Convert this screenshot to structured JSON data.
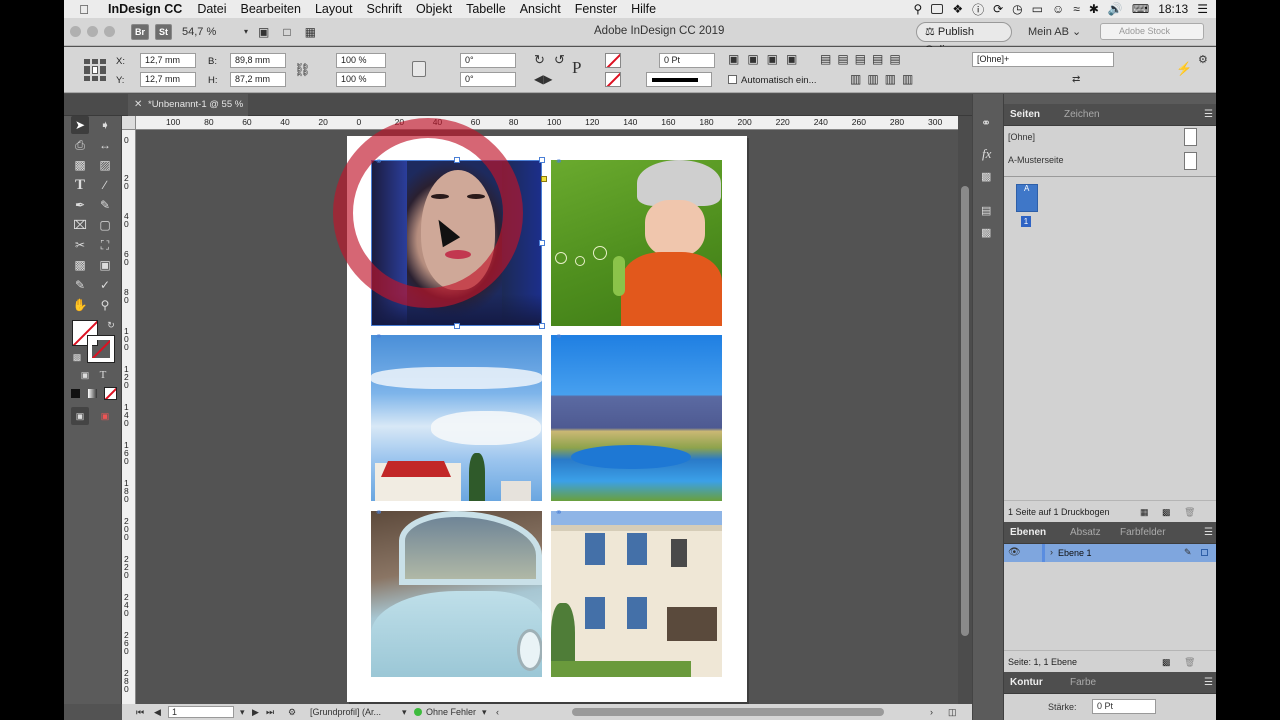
{
  "menubar": {
    "app_name": "InDesign CC",
    "items": [
      "Datei",
      "Bearbeiten",
      "Layout",
      "Schrift",
      "Objekt",
      "Tabelle",
      "Ansicht",
      "Fenster",
      "Hilfe"
    ],
    "time": "18:13"
  },
  "appbar": {
    "bridge_label": "Br",
    "stock_label": "St",
    "zoom": "54,7 %",
    "window_title": "Adobe InDesign CC 2019",
    "publish_online": "Publish Online",
    "workspace": "Mein AB",
    "stock_search_placeholder": "Adobe Stock"
  },
  "control": {
    "x_label": "X:",
    "x_value": "12,7 mm",
    "y_label": "Y:",
    "y_value": "12,7 mm",
    "w_label": "B:",
    "w_value": "89,8 mm",
    "h_label": "H:",
    "h_value": "87,2 mm",
    "scale_x": "100 %",
    "scale_y": "100 %",
    "rotation": "0°",
    "shear": "0°",
    "stroke_weight": "0 Pt",
    "auto_fit_label": "Automatisch ein...",
    "object_style": "[Ohne]+"
  },
  "document_tab": {
    "label": "*Unbenannt-1 @ 55 %"
  },
  "rulers": {
    "horizontal": [
      "100",
      "80",
      "60",
      "40",
      "20",
      "0",
      "20",
      "40",
      "60",
      "80",
      "100",
      "120",
      "140",
      "160",
      "180",
      "200",
      "220",
      "240",
      "260",
      "280",
      "300"
    ],
    "vertical": [
      "0",
      "2 0",
      "4 0",
      "6 0",
      "8 0",
      "1 0 0",
      "1 2 0",
      "1 4 0",
      "1 6 0",
      "1 8 0",
      "2 0 0",
      "2 2 0",
      "2 4 0",
      "2 6 0",
      "2 8 0"
    ]
  },
  "status": {
    "page": "1",
    "profile": "[Grundprofil] (Ar...",
    "preflight": "Ohne Fehler"
  },
  "pages_panel": {
    "tabs": [
      "Seiten",
      "Zeichen"
    ],
    "none_master": "[Ohne]",
    "a_master": "A-Musterseite",
    "page_thumb_label": "A",
    "page_number": "1",
    "footer": "1 Seite auf 1 Druckbogen"
  },
  "layers_panel": {
    "tabs": [
      "Ebenen",
      "Absatz",
      "Farbfelder"
    ],
    "layer_name": "Ebene 1",
    "footer": "Seite: 1, 1 Ebene"
  },
  "stroke_panel": {
    "tabs": [
      "Kontur",
      "Farbe"
    ],
    "weight_label": "Stärke:",
    "weight_value": "0 Pt"
  },
  "colors": {
    "selection": "#4a7fd6",
    "highlight_ring": "#c0142a",
    "layer_color": "#5a8de0"
  }
}
